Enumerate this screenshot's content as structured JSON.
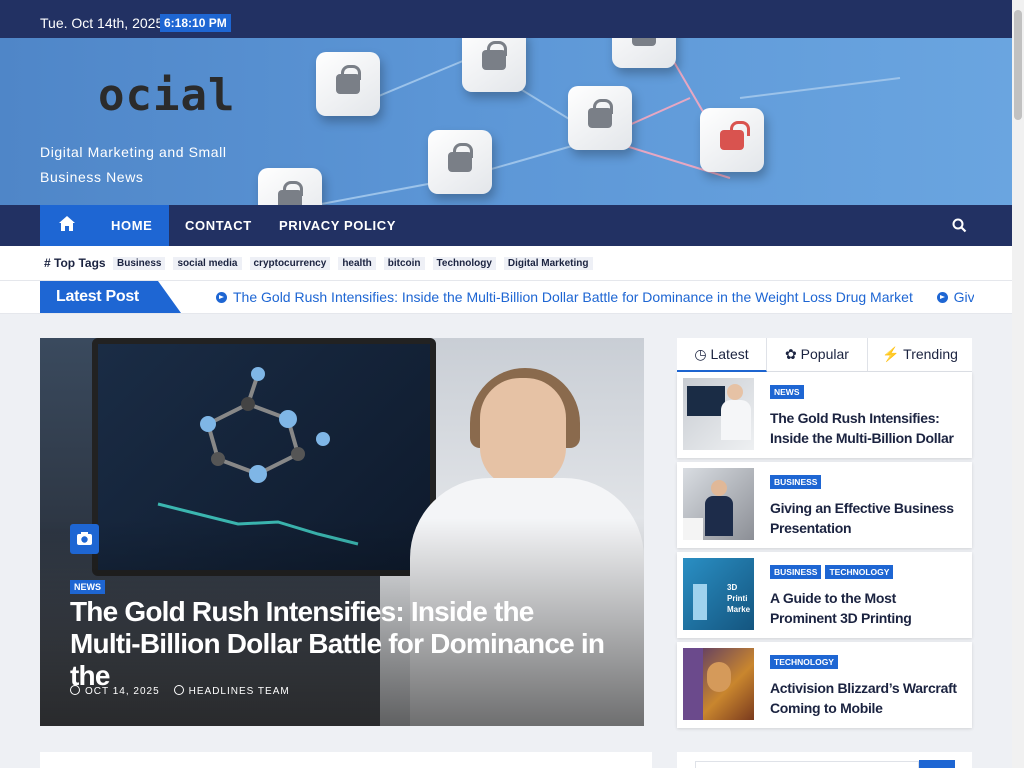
{
  "topbar": {
    "date": "Tue. Oct 14th, 2025",
    "time": "6:18:10 PM"
  },
  "header": {
    "logo_text": "ocial",
    "tagline": "Digital Marketing and Small Business News"
  },
  "nav": {
    "items": [
      {
        "label": "HOME",
        "active": true
      },
      {
        "label": "CONTACT",
        "active": false
      },
      {
        "label": "PRIVACY POLICY",
        "active": false
      }
    ],
    "icons": {
      "home": "home-icon",
      "search": "search-icon"
    }
  },
  "top_tags": {
    "label": "Top Tags",
    "tags": [
      "Business",
      "social media",
      "cryptocurrency",
      "health",
      "bitcoin",
      "Technology",
      "Digital Marketing"
    ]
  },
  "ticker": {
    "label": "Latest Post",
    "items": [
      "The Gold Rush Intensifies: Inside the Multi-Billion Dollar Battle for Dominance in the Weight Loss Drug Market",
      "Giving an Effe"
    ]
  },
  "hero": {
    "category": "NEWS",
    "title": "The Gold Rush Intensifies: Inside the Multi-Billion Dollar Battle for Dominance in the",
    "date": "OCT 14, 2025",
    "author": "HEADLINES TEAM"
  },
  "sidebar": {
    "tabs": [
      {
        "label": "Latest",
        "icon": "clock-icon"
      },
      {
        "label": "Popular",
        "icon": "fire-icon"
      },
      {
        "label": "Trending",
        "icon": "bolt-icon"
      }
    ],
    "posts": [
      {
        "categories": [
          "NEWS"
        ],
        "title": "The Gold Rush Intensifies: Inside the Multi-Billion Dollar"
      },
      {
        "categories": [
          "BUSINESS"
        ],
        "title": "Giving an Effective Business Presentation"
      },
      {
        "categories": [
          "BUSINESS",
          "TECHNOLOGY"
        ],
        "title": "A Guide to the Most Prominent 3D Printing",
        "thumb_text": "3D Printi Marke"
      },
      {
        "categories": [
          "TECHNOLOGY"
        ],
        "title": "Activision Blizzard’s Warcraft Coming to Mobile"
      }
    ]
  },
  "colors": {
    "navy": "#223163",
    "accent": "#1e66d3"
  }
}
